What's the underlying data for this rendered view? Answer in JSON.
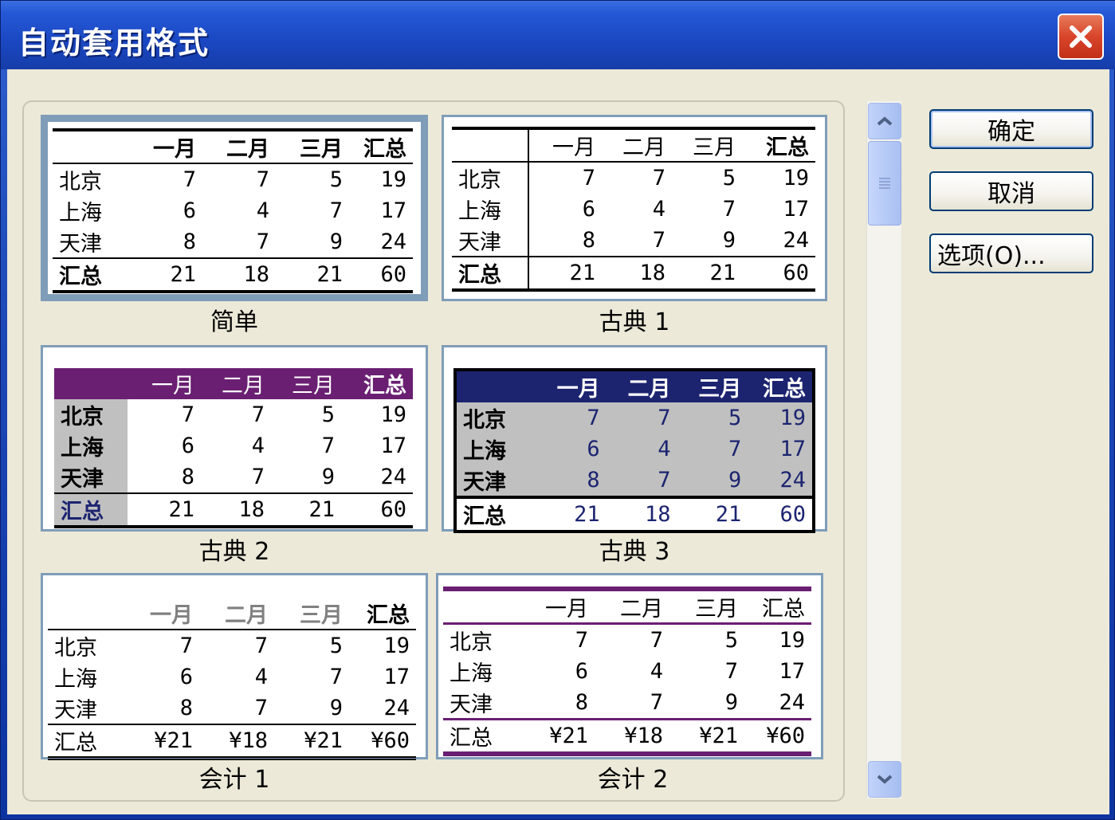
{
  "window": {
    "title": "自动套用格式",
    "close_icon": "close-icon"
  },
  "buttons": {
    "ok": "确定",
    "cancel": "取消",
    "options": "选项(O)..."
  },
  "formats": [
    {
      "label": "简单",
      "headers": [
        "",
        "一月",
        "二月",
        "三月",
        "汇总"
      ],
      "rows": [
        [
          "北京",
          "7",
          "7",
          "5",
          "19"
        ],
        [
          "上海",
          "6",
          "4",
          "7",
          "17"
        ],
        [
          "天津",
          "8",
          "7",
          "9",
          "24"
        ],
        [
          "汇总",
          "21",
          "18",
          "21",
          "60"
        ]
      ]
    },
    {
      "label": "古典 1",
      "headers": [
        "",
        "一月",
        "二月",
        "三月",
        "汇总"
      ],
      "rows": [
        [
          "北京",
          "7",
          "7",
          "5",
          "19"
        ],
        [
          "上海",
          "6",
          "4",
          "7",
          "17"
        ],
        [
          "天津",
          "8",
          "7",
          "9",
          "24"
        ],
        [
          "汇总",
          "21",
          "18",
          "21",
          "60"
        ]
      ]
    },
    {
      "label": "古典 2",
      "headers": [
        "",
        "一月",
        "二月",
        "三月",
        "汇总"
      ],
      "rows": [
        [
          "北京",
          "7",
          "7",
          "5",
          "19"
        ],
        [
          "上海",
          "6",
          "4",
          "7",
          "17"
        ],
        [
          "天津",
          "8",
          "7",
          "9",
          "24"
        ],
        [
          "汇总",
          "21",
          "18",
          "21",
          "60"
        ]
      ]
    },
    {
      "label": "古典 3",
      "headers": [
        "",
        "一月",
        "二月",
        "三月",
        "汇总"
      ],
      "rows": [
        [
          "北京",
          "7",
          "7",
          "5",
          "19"
        ],
        [
          "上海",
          "6",
          "4",
          "7",
          "17"
        ],
        [
          "天津",
          "8",
          "7",
          "9",
          "24"
        ],
        [
          "汇总",
          "21",
          "18",
          "21",
          "60"
        ]
      ]
    },
    {
      "label": "会计 1",
      "headers": [
        "",
        "一月",
        "二月",
        "三月",
        "汇总"
      ],
      "rows": [
        [
          "北京",
          "7",
          "7",
          "5",
          "19"
        ],
        [
          "上海",
          "6",
          "4",
          "7",
          "17"
        ],
        [
          "天津",
          "8",
          "7",
          "9",
          "24"
        ],
        [
          "汇总",
          "¥21",
          "¥18",
          "¥21",
          "¥60"
        ]
      ]
    },
    {
      "label": "会计 2",
      "headers": [
        "",
        "一月",
        "二月",
        "三月",
        "汇总"
      ],
      "rows": [
        [
          "北京",
          "7",
          "7",
          "5",
          "19"
        ],
        [
          "上海",
          "6",
          "4",
          "7",
          "17"
        ],
        [
          "天津",
          "8",
          "7",
          "9",
          "24"
        ],
        [
          "汇总",
          "¥21",
          "¥18",
          "¥21",
          "¥60"
        ]
      ]
    }
  ],
  "colors": {
    "classic2_header": "#6a1f72",
    "classic3_header": "#1c2470",
    "accounting2_rule": "#6a1f72",
    "label_gray": "#c0c0c0",
    "classic3_value": "#1c2470"
  }
}
